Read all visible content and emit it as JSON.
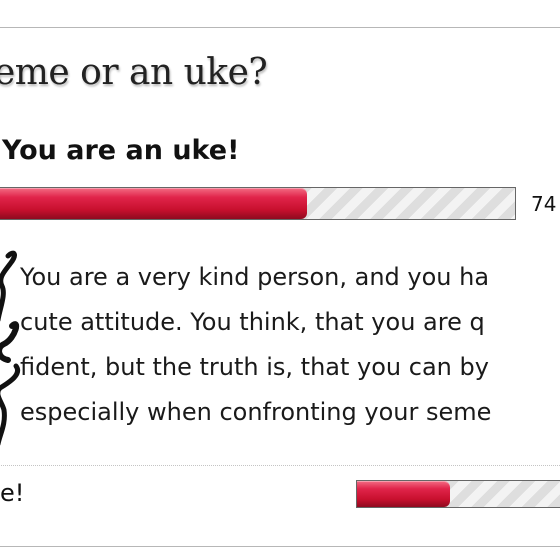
{
  "quiz": {
    "question": "seme or an uke?"
  },
  "result": {
    "title": "You are an uke!",
    "percent_label": "74",
    "percent": 61,
    "description": "You are a very kind person, and you ha\ncute attitude. You think, that you are q\nfident, but the truth is, that you can by\nespecially when confronting your seme"
  },
  "other_result": {
    "label": "e!",
    "percent": 41
  },
  "colors": {
    "bar_fill": "#c8102e",
    "bar_track": "#e6e6e6",
    "border": "#b7b7b7"
  },
  "icons": {
    "doodle": "ink-scribble-icon"
  }
}
